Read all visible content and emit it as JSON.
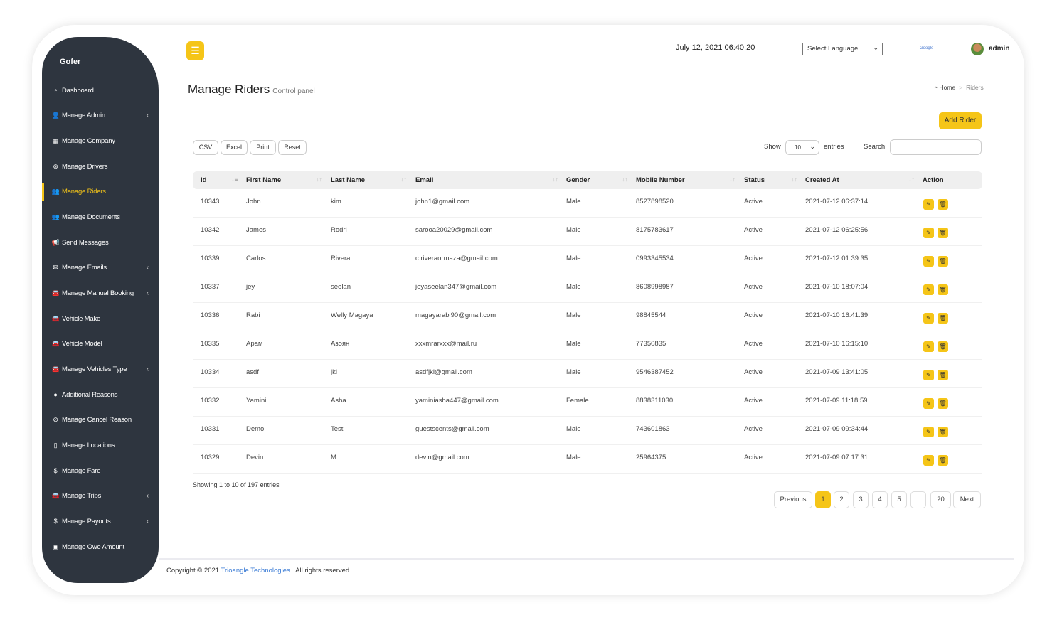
{
  "brand": "Gofer",
  "colors": {
    "accent": "#f5c518",
    "sidebar": "#2e353f",
    "link": "#3a7bd5"
  },
  "sidebar": {
    "items": [
      {
        "label": "Dashboard",
        "icon": "dashboard-icon",
        "glyph": "◔",
        "chevron": false
      },
      {
        "label": "Manage Admin",
        "icon": "user-plus-icon",
        "glyph": "👤",
        "chevron": true
      },
      {
        "label": "Manage Company",
        "icon": "building-icon",
        "glyph": "▦",
        "chevron": false
      },
      {
        "label": "Manage Drivers",
        "icon": "steering-wheel-icon",
        "glyph": "⊛",
        "chevron": false
      },
      {
        "label": "Manage Riders",
        "icon": "users-icon",
        "glyph": "👥",
        "chevron": false,
        "active": true
      },
      {
        "label": "Manage Documents",
        "icon": "users-icon",
        "glyph": "👥",
        "chevron": false
      },
      {
        "label": "Send Messages",
        "icon": "bullhorn-icon",
        "glyph": "📢",
        "chevron": false
      },
      {
        "label": "Manage Emails",
        "icon": "envelope-icon",
        "glyph": "✉",
        "chevron": true
      },
      {
        "label": "Manage Manual Booking",
        "icon": "car-icon",
        "glyph": "🚘",
        "chevron": true
      },
      {
        "label": "Vehicle Make",
        "icon": "car-icon",
        "glyph": "🚘",
        "chevron": false
      },
      {
        "label": "Vehicle Model",
        "icon": "car-icon",
        "glyph": "🚘",
        "chevron": false
      },
      {
        "label": "Manage Vehicles Type",
        "icon": "car-icon",
        "glyph": "🚘",
        "chevron": true
      },
      {
        "label": "Additional Reasons",
        "icon": "comment-icon",
        "glyph": "●",
        "chevron": false
      },
      {
        "label": "Manage Cancel Reason",
        "icon": "ban-icon",
        "glyph": "⊘",
        "chevron": false
      },
      {
        "label": "Manage Locations",
        "icon": "map-icon",
        "glyph": "▯",
        "chevron": false
      },
      {
        "label": "Manage Fare",
        "icon": "dollar-icon",
        "glyph": "$",
        "chevron": false
      },
      {
        "label": "Manage Trips",
        "icon": "car-icon",
        "glyph": "🚘",
        "chevron": true
      },
      {
        "label": "Manage Payouts",
        "icon": "dollar-icon",
        "glyph": "$",
        "chevron": true
      },
      {
        "label": "Manage Owe Amount",
        "icon": "money-icon",
        "glyph": "▣",
        "chevron": false
      }
    ]
  },
  "header": {
    "datetime": "July 12, 2021 06:40:20",
    "language": "Select Language",
    "google": "Google",
    "user": "admin"
  },
  "page": {
    "title": "Manage Riders",
    "subtitle": "Control panel",
    "breadcrumb": {
      "home": "Home",
      "current": "Riders"
    },
    "add_button": "Add Rider"
  },
  "toolbar": {
    "buttons": [
      "CSV",
      "Excel",
      "Print",
      "Reset"
    ],
    "show": "Show",
    "entries_value": "10",
    "entries": "entries",
    "search_label": "Search:",
    "search_value": ""
  },
  "table": {
    "columns": [
      "Id",
      "First Name",
      "Last Name",
      "Email",
      "Gender",
      "Mobile Number",
      "Status",
      "Created At",
      "Action"
    ],
    "rows": [
      [
        "10343",
        "John",
        "kim",
        "john1@gmail.com",
        "Male",
        "8527898520",
        "Active",
        "2021-07-12 06:37:14"
      ],
      [
        "10342",
        "James",
        "Rodri",
        "sarooa20029@gmail.com",
        "Male",
        "8175783617",
        "Active",
        "2021-07-12 06:25:56"
      ],
      [
        "10339",
        "Carlos",
        "Rivera",
        "c.riveraormaza@gmail.com",
        "Male",
        "0993345534",
        "Active",
        "2021-07-12 01:39:35"
      ],
      [
        "10337",
        "jey",
        "seelan",
        "jeyaseelan347@gmail.com",
        "Male",
        "8608998987",
        "Active",
        "2021-07-10 18:07:04"
      ],
      [
        "10336",
        "Rabi",
        "Welly Magaya",
        "magayarabi90@gmail.com",
        "Male",
        "98845544",
        "Active",
        "2021-07-10 16:41:39"
      ],
      [
        "10335",
        "Арам",
        "Азоян",
        "xxxmrarxxx@mail.ru",
        "Male",
        "77350835",
        "Active",
        "2021-07-10 16:15:10"
      ],
      [
        "10334",
        "asdf",
        "jkl",
        "asdfjkl@gmail.com",
        "Male",
        "9546387452",
        "Active",
        "2021-07-09 13:41:05"
      ],
      [
        "10332",
        "Yamini",
        "Asha",
        "yaminiasha447@gmail.com",
        "Female",
        "8838311030",
        "Active",
        "2021-07-09 11:18:59"
      ],
      [
        "10331",
        "Demo",
        "Test",
        "guestscents@gmail.com",
        "Male",
        "743601863",
        "Active",
        "2021-07-09 09:34:44"
      ],
      [
        "10329",
        "Devin",
        "M",
        "devin@gmail.com",
        "Male",
        "25964375",
        "Active",
        "2021-07-09 07:17:31"
      ]
    ]
  },
  "pagination": {
    "info": "Showing 1 to 10 of 197 entries",
    "items": [
      "Previous",
      "1",
      "2",
      "3",
      "4",
      "5",
      "...",
      "20",
      "Next"
    ],
    "current": "1"
  },
  "footer": {
    "prefix": "Copyright © 2021",
    "company": "Trioangle Technologies",
    "suffix": ". All rights reserved."
  }
}
